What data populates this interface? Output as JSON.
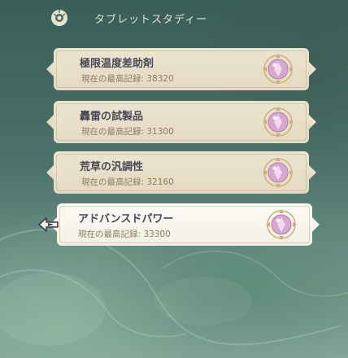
{
  "header": {
    "title": "タブレットスタディー",
    "icon": "tablet-emblem-icon"
  },
  "record_prefix": "現在の最高記録: ",
  "cards": [
    {
      "title": "極限温度差助剤",
      "record": "現在の最高記録: 38320",
      "icon": "crystal-orb-icon"
    },
    {
      "title": "轟雷の試製品",
      "record": "現在の最高記録: 31300",
      "icon": "crystal-orb-icon"
    },
    {
      "title": "荒草の汎調性",
      "record": "現在の最高記録: 32160",
      "icon": "crystal-orb-icon"
    },
    {
      "title": "アドバンスドパワー",
      "record": "現在の最高記録: 33300",
      "icon": "crystal-orb-icon",
      "selected": true
    }
  ],
  "colors": {
    "card": "#e8dfc8",
    "selected_card": "#f8f6ee",
    "title": "#4a4a5a",
    "record": "#8b7d62",
    "gem": "#d8a7cf"
  }
}
